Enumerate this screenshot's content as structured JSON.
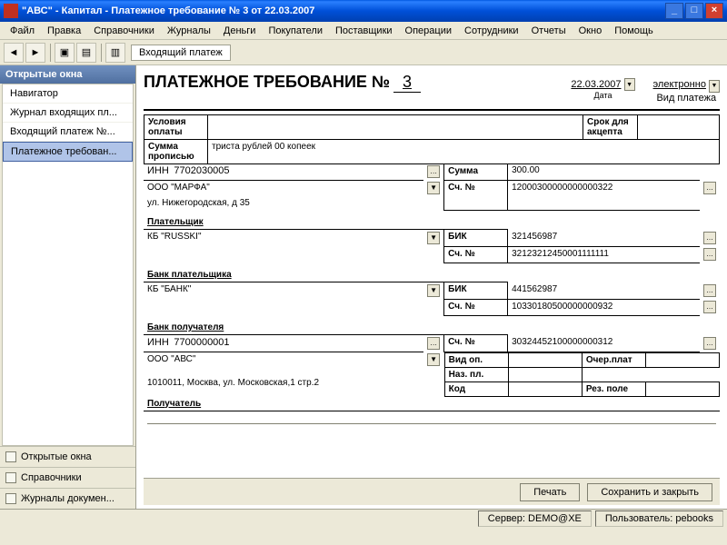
{
  "window": {
    "title": "\"АВС\" - Капитал - Платежное требование № 3 от 22.03.2007"
  },
  "menu": [
    "Файл",
    "Правка",
    "Справочники",
    "Журналы",
    "Деньги",
    "Покупатели",
    "Поставщики",
    "Операции",
    "Сотрудники",
    "Отчеты",
    "Окно",
    "Помощь"
  ],
  "crumb": "Входящий платеж",
  "sidebar": {
    "header": "Открытые окна",
    "items": [
      "Навигатор",
      "Журнал входящих пл...",
      "Входящий платеж №...",
      "Платежное требован..."
    ],
    "selected": 3,
    "bottom": [
      "Открытые окна",
      "Справочники",
      "Журналы докумен..."
    ]
  },
  "doc": {
    "title": "ПЛАТЕЖНОЕ ТРЕБОВАНИЕ №",
    "num": "3",
    "date": "22.03.2007",
    "date_label": "Дата",
    "type": "электронно",
    "type_label": "Вид платежа",
    "labels": {
      "usl": "Условия оплаты",
      "srok": "Срок для акцепта",
      "sum_words": "Сумма прописью",
      "sum_words_val": "триста рублей 00 копеек",
      "inn": "ИНН",
      "summa": "Сумма",
      "sch": "Сч. №",
      "platelshik": "Плательщик",
      "bik": "БИК",
      "bank_plat": "Банк плательщика",
      "bank_pol": "Банк получателя",
      "vid_op": "Вид оп.",
      "naz_pl": "Наз. пл.",
      "kod": "Код",
      "ochered": "Очер.плат",
      "rez": "Рез. поле",
      "poluchatel": "Получатель"
    },
    "payer": {
      "inn": "7702030005",
      "name": "ООО \"МАРФА\"",
      "addr": "ул. Нижегородская, д 35",
      "summa": "300.00",
      "sch": "12000300000000000322"
    },
    "payer_bank": {
      "name": "КБ \"RUSSKI\"",
      "bik": "321456987",
      "sch": "32123212450001111111"
    },
    "recv_bank": {
      "name": "КБ \"БАНК\"",
      "bik": "441562987",
      "sch": "10330180500000000932"
    },
    "recv": {
      "inn": "7700000001",
      "name": "ООО \"АВС\"",
      "addr": "1010011, Москва, ул. Московская,1 стр.2",
      "sch": "30324452100000000312"
    }
  },
  "footer": {
    "print": "Печать",
    "save": "Сохранить и закрыть"
  },
  "status": {
    "server_l": "Сервер:",
    "server_v": "DEMO@XE",
    "user_l": "Пользователь:",
    "user_v": "pebooks"
  }
}
